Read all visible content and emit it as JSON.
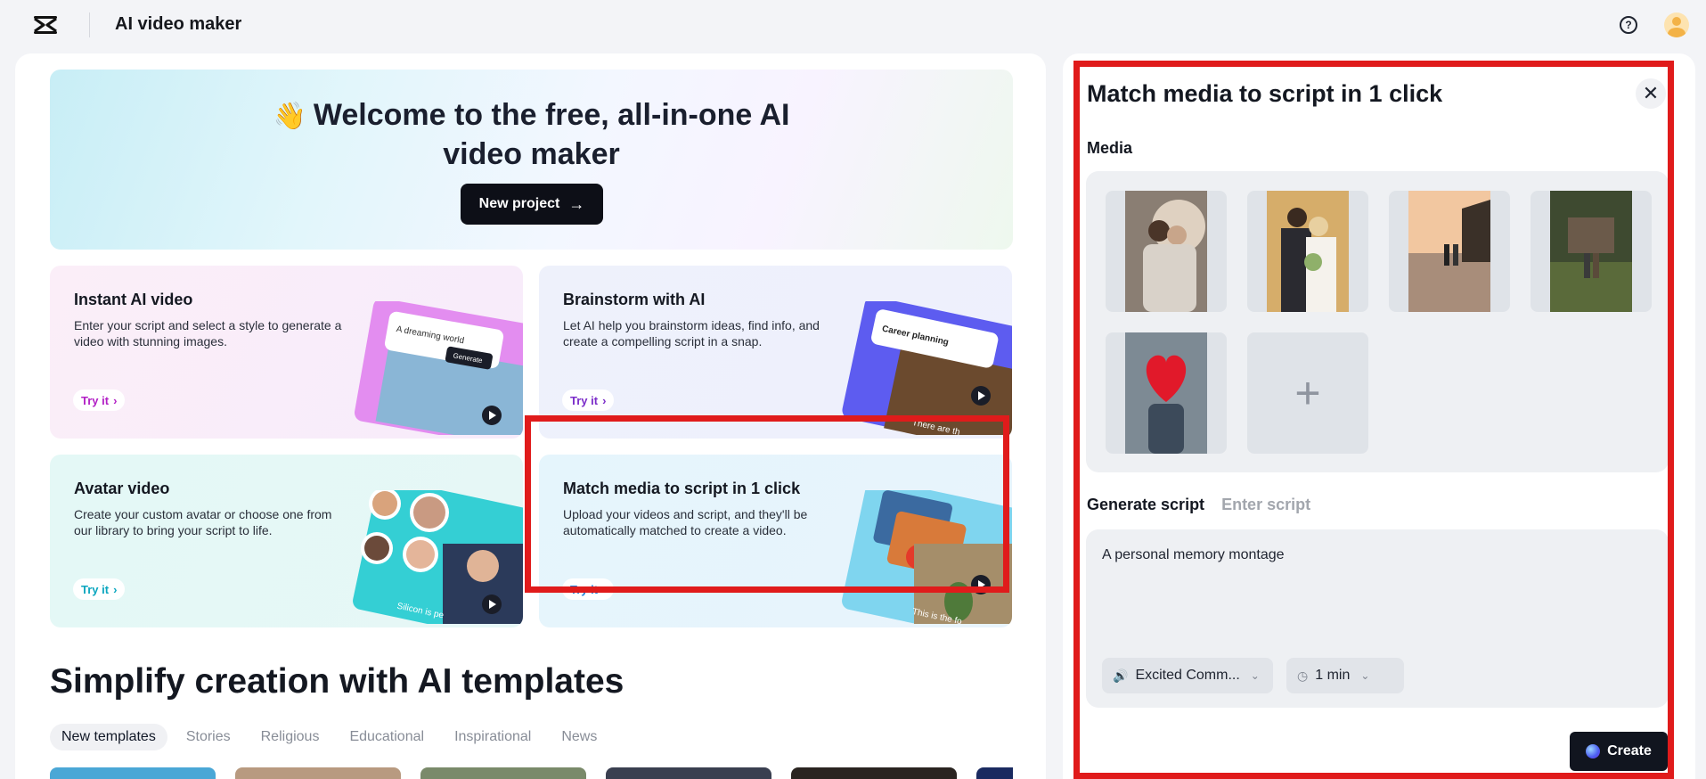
{
  "header": {
    "app_title": "AI video maker",
    "help_icon": "help-circle-icon",
    "avatar_icon": "user-avatar-icon"
  },
  "hero": {
    "wave_emoji": "👋",
    "title_line1": "Welcome to the free, all-in-one AI",
    "title_line2": "video maker",
    "new_project_label": "New project"
  },
  "cards": [
    {
      "title": "Instant AI video",
      "desc": "Enter your script and select a style to generate a video with stunning images.",
      "try_label": "Try it",
      "art_text": "A dreaming world",
      "art_button": "Generate"
    },
    {
      "title": "Brainstorm with AI",
      "desc": "Let AI help you brainstorm ideas, find info, and create a compelling script in a snap.",
      "try_label": "Try it",
      "art_text": "Career planning",
      "art_caption": "There are th"
    },
    {
      "title": "Avatar video",
      "desc": "Create your custom avatar or choose one from our library to bring your script to life.",
      "try_label": "Try it",
      "art_caption": "Silicon is pe"
    },
    {
      "title": "Match media to script in 1 click",
      "desc": "Upload your videos and script, and they'll be automatically matched to create a video.",
      "try_label": "Try it",
      "art_caption": "This is the fo"
    }
  ],
  "templates": {
    "title": "Simplify creation with AI templates",
    "tabs": [
      "New templates",
      "Stories",
      "Religious",
      "Educational",
      "Inspirational",
      "News"
    ],
    "active_tab": "New templates"
  },
  "right_panel": {
    "title": "Match media to script in 1 click",
    "media_label": "Media",
    "script_tabs": [
      "Generate script",
      "Enter script"
    ],
    "script_text": "A personal memory montage",
    "voice_label": "Excited Comm...",
    "duration_label": "1 min",
    "create_label": "Create"
  },
  "colors": {
    "highlight": "#e01b1b",
    "dark_button": "#0d0f17"
  }
}
